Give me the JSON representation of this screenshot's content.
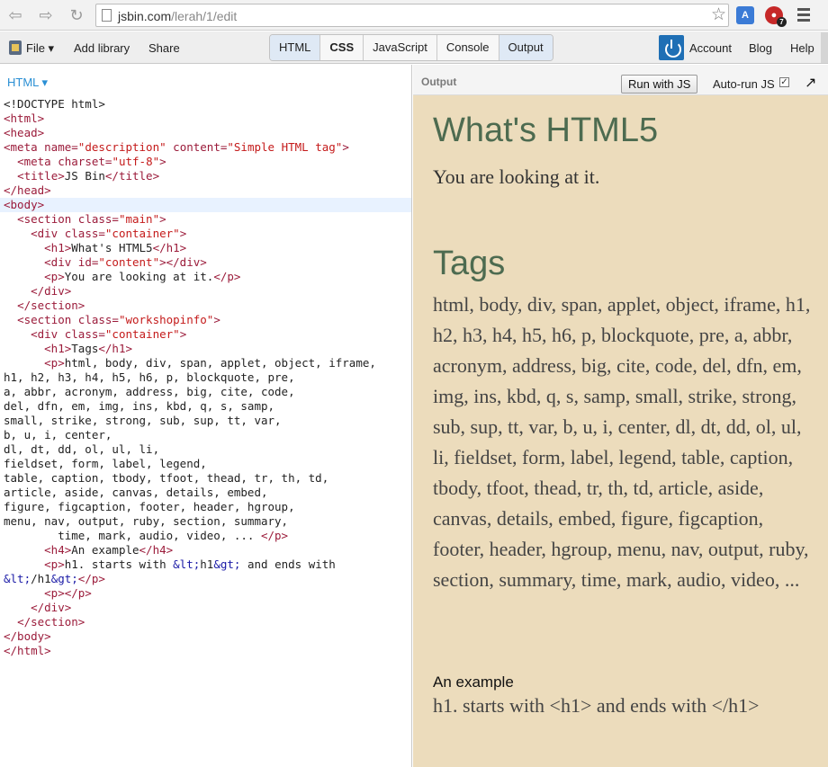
{
  "browser": {
    "url_host": "jsbin.com",
    "url_path": "/lerah/1/edit",
    "back_icon": "back-arrow-icon",
    "forward_icon": "forward-arrow-icon",
    "reload_icon": "reload-icon",
    "star_icon": "bookmark-star-icon",
    "ext_badge": "7"
  },
  "toolbar": {
    "file_label": "File ▾",
    "add_library": "Add library",
    "share": "Share",
    "tabs": [
      {
        "label": "HTML",
        "active": true
      },
      {
        "label": "CSS",
        "active": false
      },
      {
        "label": "JavaScript",
        "active": false
      },
      {
        "label": "Console",
        "active": false
      },
      {
        "label": "Output",
        "active": true
      }
    ],
    "account": "Account",
    "blog": "Blog",
    "help": "Help"
  },
  "editor": {
    "label": "HTML ▾"
  },
  "output": {
    "label": "Output",
    "run_button": "Run with JS",
    "autorun": "Auto-run JS",
    "checkbox": "✓",
    "h1": "What's HTML5",
    "p": "You are looking at it.",
    "h1b": "Tags",
    "tags": "html, body, div, span, applet, object, iframe, h1, h2, h3, h4, h5, h6, p, blockquote, pre, a, abbr, acronym, address, big, cite, code, del, dfn, em, img, ins, kbd, q, s, samp, small, strike, strong, sub, sup, tt, var, b, u, i, center, dl, dt, dd, ol, ul, li, fieldset, form, label, legend, table, caption, tbody, tfoot, thead, tr, th, td, article, aside, canvas, details, embed, figure, figcaption, footer, header, hgroup, menu, nav, output, ruby, section, summary, time, mark, audio, video, ...",
    "h4": "An example",
    "p2": "h1. starts with <h1> and ends with </h1>"
  },
  "colors": {
    "output_bg": "#ecdcbc",
    "heading_green": "#4d6b50",
    "tab_active": "#dfe9f5",
    "editor_label": "#2a8fd4"
  }
}
